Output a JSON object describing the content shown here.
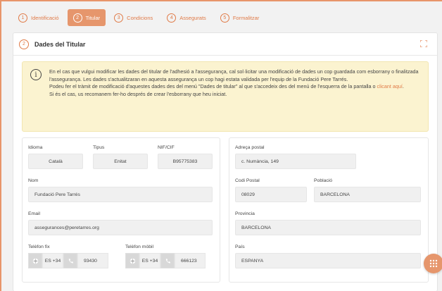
{
  "steps": [
    {
      "num": "1",
      "label": "Identificació"
    },
    {
      "num": "2",
      "label": "Titular"
    },
    {
      "num": "3",
      "label": "Condicions"
    },
    {
      "num": "4",
      "label": "Assegurats"
    },
    {
      "num": "5",
      "label": "Formalitzar"
    }
  ],
  "card": {
    "num": "2",
    "title": "Dades del Titular"
  },
  "alert": {
    "p1": "En el cas que vulgui modificar les dades del titular de l'adhesió a l'assegurança, cal sol·licitar una modificació de dades un cop guardada com esborrany o finalitzada l'assegurança. Les dades s'actualitzaran en aquesta assegurança un cop hagi estata validada per l'equip de la Fundació Pere Tarrés.",
    "p2_before": "Podeu fer el tràmit de modificació d'aquestes dades des del menú \"Dades de titular\" al que s'accedeix des del menú de l'esquerra de la pantalla o ",
    "p2_link": "clicant aquí",
    "p2_after": ".",
    "p3": "Si és el cas, us recomanem fer-ho després de crear l'esborrany que heu iniciat."
  },
  "left": {
    "idioma_label": "Idioma",
    "idioma": "Català",
    "tipus_label": "Tipus",
    "tipus": "Enitat",
    "nif_label": "NIF/CIF",
    "nif": "B95775383",
    "nom_label": "Nom",
    "nom": "Fundació Pere Tarrés",
    "email_label": "Email",
    "email": "assegurances@peretarres.org",
    "tel_fix_label": "Telèfon fix",
    "tel_fix_prefix": "ES +34",
    "tel_fix": "93430",
    "tel_mobil_label": "Telèfon mòbil",
    "tel_mobil_prefix": "ES +34",
    "tel_mobil": "666123"
  },
  "right": {
    "adreca_label": "Adreça postal",
    "adreca": "c. Numància, 149",
    "cp_label": "Codi Postal",
    "cp": "08029",
    "poblacio_label": "Població",
    "poblacio": "BARCELONA",
    "provincia_label": "Provincia",
    "provincia": "BARCELONA",
    "pais_label": "País",
    "pais": "ESPANYA"
  },
  "colors": {
    "accent": "#e6966c",
    "alert_bg": "#fbf3d0"
  },
  "icons": {
    "info": "info-icon",
    "expand": "expand-icon",
    "globe": "globe-icon",
    "phone": "phone-icon",
    "apps": "apps-grid-icon"
  }
}
